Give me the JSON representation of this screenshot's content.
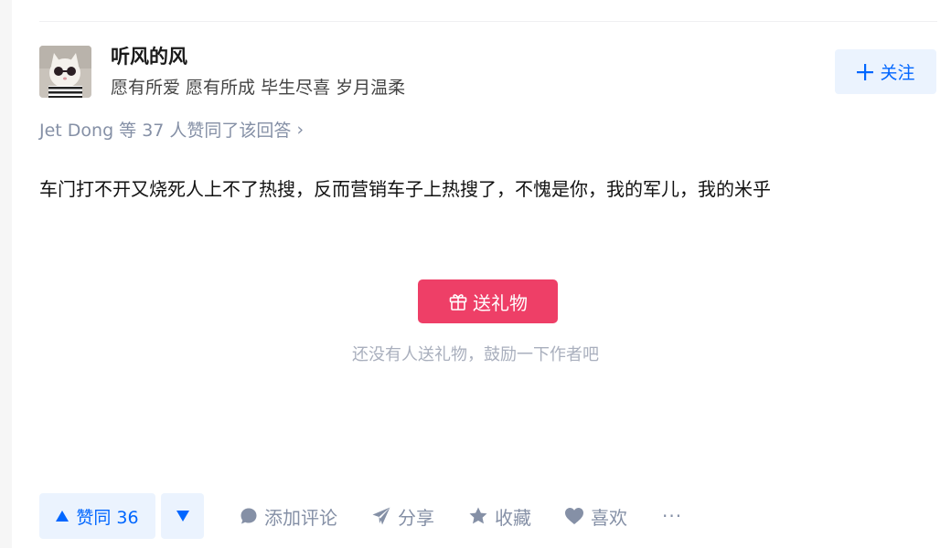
{
  "author": {
    "name": "听风的风",
    "bio": "愿有所爱 愿有所成 毕生尽喜 岁月温柔",
    "follow_label": "关注"
  },
  "voters": {
    "text": "Jet Dong 等 37 人赞同了该回答",
    "chevron": "›"
  },
  "answer": {
    "content": "车门打不开又烧死人上不了热搜，反而营销车子上热搜了，不愧是你，我的军儿，我的米乎"
  },
  "gift": {
    "button_label": "送礼物",
    "hint": "还没有人送礼物，鼓励一下作者吧"
  },
  "actions": {
    "vote_up_label": "赞同 36",
    "comment_label": "添加评论",
    "share_label": "分享",
    "collect_label": "收藏",
    "like_label": "喜欢",
    "more_label": "···"
  },
  "colors": {
    "brand_blue": "#0066ff",
    "gift_red": "#ee3f67",
    "meta_gray": "#8590a6"
  },
  "icons": {
    "follow": "plus-icon",
    "gift": "gift-icon",
    "vote_up": "triangle-up-icon",
    "vote_down": "triangle-down-icon",
    "comment": "comment-bubble-icon",
    "share": "paper-plane-icon",
    "collect": "star-icon",
    "like": "heart-icon"
  }
}
